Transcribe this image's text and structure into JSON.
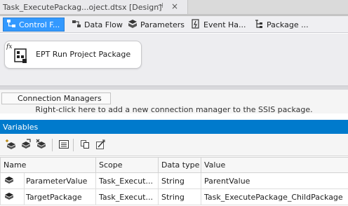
{
  "document_tab": {
    "title": "Task_ExecutePackag...oject.dtsx [Design]",
    "pin_glyph": "⊣",
    "close_glyph": "×"
  },
  "designer_tabs": [
    {
      "label": "Control F...",
      "active": true
    },
    {
      "label": "Data Flow",
      "active": false
    },
    {
      "label": "Parameters",
      "active": false
    },
    {
      "label": "Event Ha...",
      "active": false
    },
    {
      "label": "Package ...",
      "active": false
    }
  ],
  "canvas": {
    "task_label": "EPT Run Project Package",
    "task_badge": "fx"
  },
  "connection_managers": {
    "tab_label": "Connection Managers",
    "hint": "Right-click here to add a new connection manager to the SSIS package."
  },
  "variables": {
    "title": "Variables",
    "columns": [
      "Name",
      "Scope",
      "Data type",
      "Value"
    ],
    "rows": [
      {
        "name": "ParameterValue",
        "scope": "Task_Execut...",
        "type": "String",
        "value": "ParentValue"
      },
      {
        "name": "TargetPackage",
        "scope": "Task_Execut...",
        "type": "String",
        "value": "Task_ExecutePackage_ChildPackage"
      }
    ]
  },
  "colors": {
    "accent": "#007acc",
    "active_tab": "#3399ff",
    "canvas_bg": "#ededf0"
  },
  "icons": {
    "toolbar": [
      "add-variable-icon",
      "move-variable-icon",
      "delete-variable-icon",
      "grid-options-icon",
      "copy-icon",
      "expression-icon"
    ]
  }
}
